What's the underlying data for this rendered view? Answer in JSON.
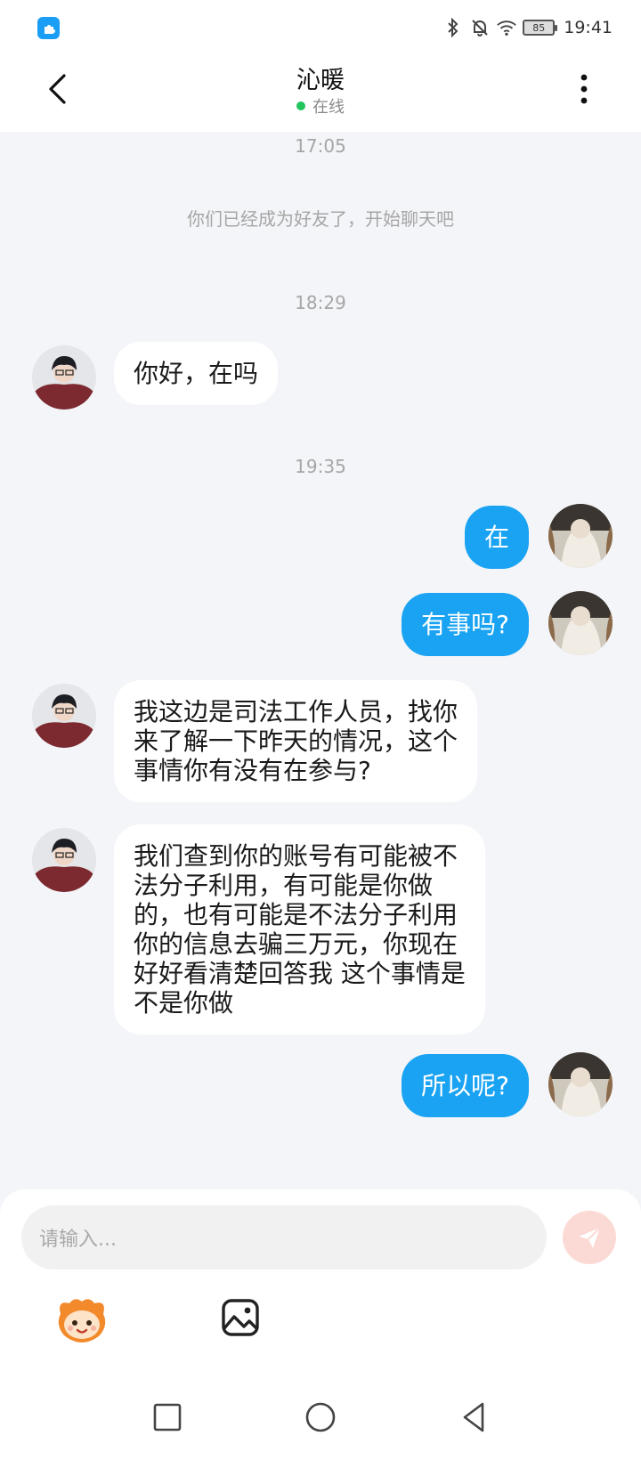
{
  "status_bar": {
    "time": "19:41",
    "battery": "85",
    "icons": [
      "app-badge-icon",
      "bluetooth-icon",
      "mute-bell-icon",
      "wifi-icon",
      "battery-icon"
    ]
  },
  "header": {
    "title": "沁暖",
    "presence": "在线",
    "back_icon": "chevron-left-icon",
    "more_icon": "more-vertical-icon"
  },
  "chat": {
    "timestamps": [
      "17:05",
      "18:29",
      "19:35"
    ],
    "system_message": "你们已经成为好友了，开始聊天吧",
    "messages": [
      {
        "from": "them",
        "lines": [
          "你好，在吗"
        ]
      },
      {
        "from": "me",
        "lines": [
          "在"
        ]
      },
      {
        "from": "me",
        "lines": [
          "有事吗?"
        ]
      },
      {
        "from": "them",
        "lines": [
          "我这边是司法工作人员，找你",
          "来了解一下昨天的情况，这个",
          "事情你有没有在参与?"
        ]
      },
      {
        "from": "them",
        "lines": [
          "我们查到你的账号有可能被不",
          "法分子利用，有可能是你做",
          "的，也有可能是不法分子利用",
          "你的信息去骗三万元，你现在",
          "好好看清楚回答我 这个事情是",
          "不是你做"
        ]
      },
      {
        "from": "me",
        "lines": [
          "所以呢?"
        ]
      }
    ]
  },
  "composer": {
    "placeholder": "请输入...",
    "send_icon": "send-icon",
    "emoji_icon": "emoji-mascot-icon",
    "image_icon": "image-icon"
  },
  "nav": {
    "icons": [
      "recents-square-icon",
      "home-circle-icon",
      "back-triangle-icon"
    ]
  },
  "colors": {
    "accent": "#1aa3f2",
    "online": "#22c55e",
    "background": "#f4f5f8"
  }
}
